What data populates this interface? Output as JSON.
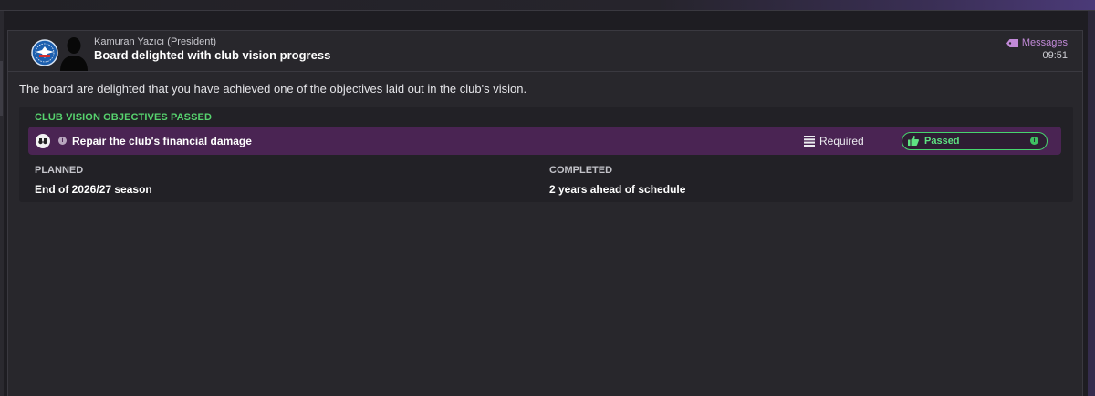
{
  "message": {
    "sender": "Kamuran Yazıcı (President)",
    "subject": "Board delighted with club vision progress",
    "category_label": "Messages",
    "time": "09:51",
    "body": "The board are delighted that you have achieved one of the objectives laid out in the club's vision."
  },
  "vision_card": {
    "title": "CLUB VISION OBJECTIVES PASSED",
    "objective": {
      "label": "Repair the club's financial damage",
      "importance": "Required",
      "status": "Passed"
    },
    "planned_label": "PLANNED",
    "planned_value": "End of 2026/27 season",
    "completed_label": "COMPLETED",
    "completed_value": "2 years ahead of schedule"
  },
  "colors": {
    "accent_green": "#57d36e",
    "objective_row": "#4a2453",
    "messages_link": "#c28ad8",
    "panel_bg": "#28272c"
  },
  "icons": {
    "club_badge": "club-crest-icon",
    "person": "person-silhouette-icon",
    "messages": "tag-icon",
    "objective": "binoculars-icon",
    "info": "info-icon",
    "required": "stacked-bars-icon",
    "passed": "thumbs-up-icon"
  }
}
